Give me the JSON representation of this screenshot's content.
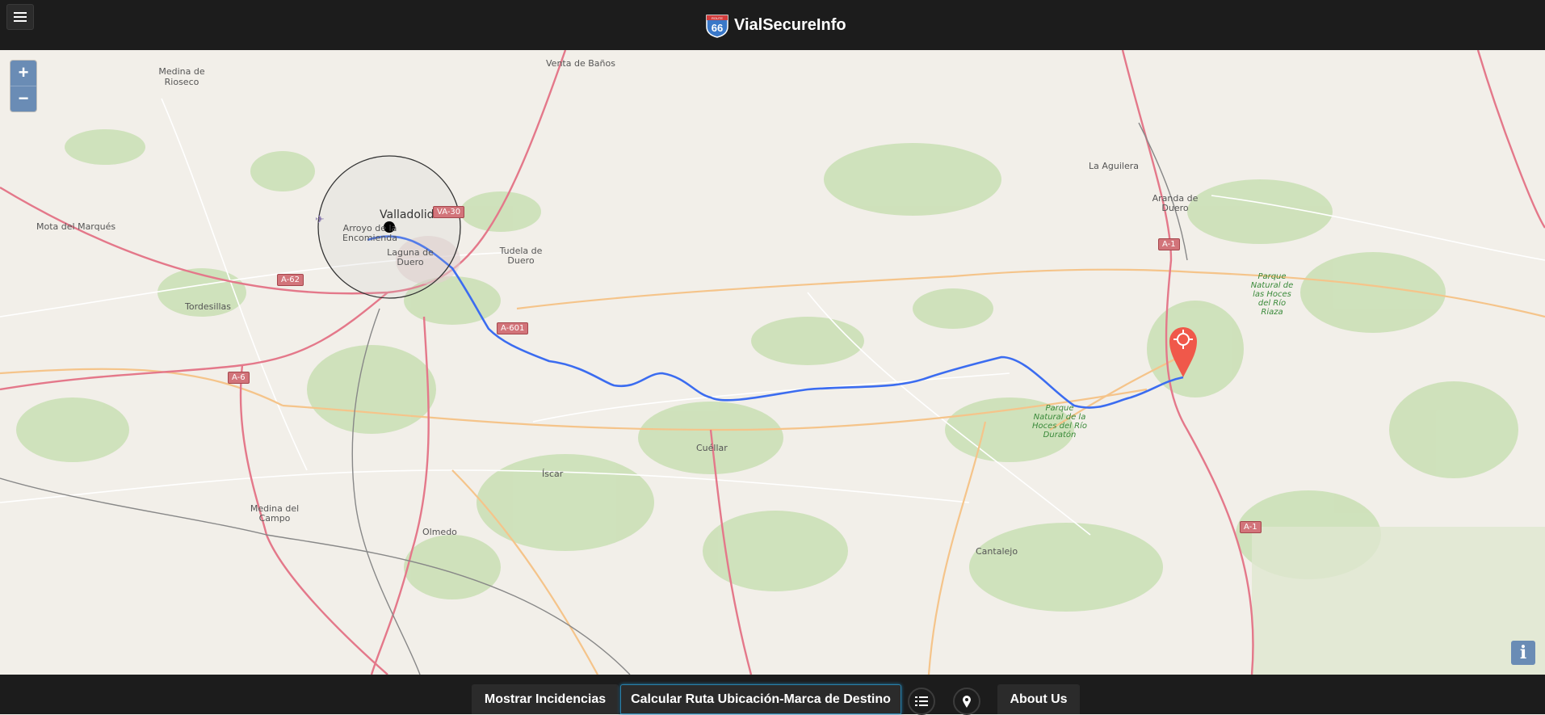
{
  "app": {
    "title": "VialSecureInfo",
    "logo_text": "66",
    "logo_top": "ROUTE"
  },
  "map": {
    "zoom_in": "+",
    "zoom_out": "−",
    "info": "i",
    "labels": {
      "venta_banos": "Venta de Baños",
      "medina_rioseco": "Medina de Rioseco",
      "mota_marques": "Mota del Marqués",
      "valladolid": "Valladolid",
      "arroyo": "Arroyo de la Encomienda",
      "laguna": "Laguna de Duero",
      "tudela": "Tudela de Duero",
      "tordesillas": "Tordesillas",
      "la_aguilera": "La Aguilera",
      "aranda": "Aranda de Duero",
      "parque_riaza": "Parque Natural de las Hoces del Río Riaza",
      "cuellar": "Cuéllar",
      "iscar": "Íscar",
      "medina_campo": "Medina del Campo",
      "olmedo": "Olmedo",
      "parque_duraton": "Parque Natural de la Hoces del Río Duratón",
      "cantalejo": "Cantalejo"
    },
    "shields": {
      "va30": "VA-30",
      "a62": "A-62",
      "a601": "A-601",
      "a6": "A-6",
      "a1_top": "A-1",
      "a1_bottom": "A-1"
    },
    "colors": {
      "route": "#3b6cf0",
      "marker": "#f0584a",
      "motorway": "#e4788a",
      "primary": "#f5c48a",
      "forest": "#add19e"
    }
  },
  "toolbar": {
    "incidents": "Mostrar Incidencias",
    "route": "Calcular Ruta Ubicación-Marca de Destino",
    "list_icon": "list-icon",
    "location_icon": "location-pin-icon",
    "about": "About Us"
  }
}
